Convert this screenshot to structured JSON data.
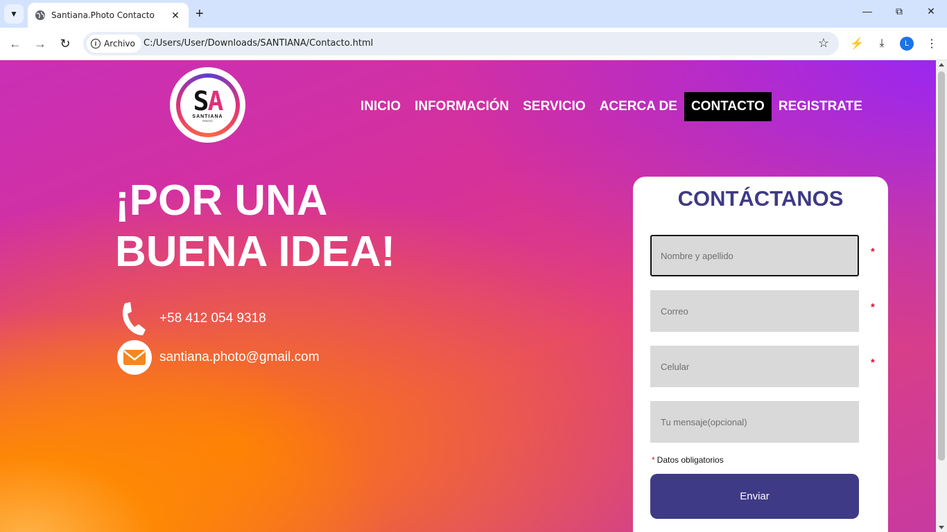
{
  "browser": {
    "tab_title": "Santiana.Photo Contacto",
    "security_chip": "Archivo",
    "url": "C:/Users/User/Downloads/SANTIANA/Contacto.html",
    "profile_initial": "L"
  },
  "logo": {
    "name": "SANTIANA",
    "sub": "PHOTO"
  },
  "nav": {
    "items": [
      {
        "label": "INICIO"
      },
      {
        "label": "INFORMACIÓN"
      },
      {
        "label": "SERVICIO"
      },
      {
        "label": "ACERCA DE"
      },
      {
        "label": "CONTACTO",
        "active": true
      },
      {
        "label": "REGISTRATE"
      }
    ]
  },
  "hero": {
    "title_line1": "¡POR UNA",
    "title_line2": "BUENA IDEA!",
    "phone": "+58 412 054 9318",
    "email": "santiana.photo@gmail.com"
  },
  "form": {
    "title": "CONTÁCTANOS",
    "fields": [
      {
        "placeholder": "Nombre y apellido",
        "required": true
      },
      {
        "placeholder": "Correo",
        "required": true
      },
      {
        "placeholder": "Celular",
        "required": true
      },
      {
        "placeholder": "Tu mensaje(opcional)",
        "required": false
      }
    ],
    "required_mark": "*",
    "required_note": "Datos obligatorios",
    "submit_label": "Enviar"
  },
  "colors": {
    "primary": "#3f3a85",
    "required": "#e0102a",
    "field_bg": "#d9d9d9",
    "active_nav_bg": "#000000"
  }
}
